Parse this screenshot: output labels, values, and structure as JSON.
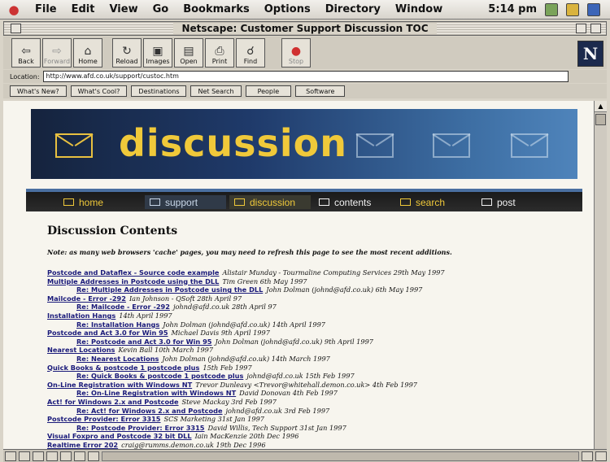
{
  "menubar": {
    "items": [
      "File",
      "Edit",
      "View",
      "Go",
      "Bookmarks",
      "Options",
      "Directory",
      "Window"
    ],
    "clock": "5:14 pm"
  },
  "window": {
    "title": "Netscape: Customer Support Discussion TOC"
  },
  "toolbar": {
    "buttons": [
      {
        "label": "Back",
        "icon": "back-arrow-icon"
      },
      {
        "label": "Forward",
        "icon": "forward-arrow-icon"
      },
      {
        "label": "Home",
        "icon": "home-icon"
      },
      {
        "label": "Reload",
        "icon": "reload-icon"
      },
      {
        "label": "Images",
        "icon": "images-icon"
      },
      {
        "label": "Open",
        "icon": "open-icon"
      },
      {
        "label": "Print",
        "icon": "print-icon"
      },
      {
        "label": "Find",
        "icon": "find-icon"
      },
      {
        "label": "Stop",
        "icon": "stop-icon"
      }
    ],
    "logo": "N"
  },
  "location": {
    "label": "Location:",
    "url": "http://www.afd.co.uk/support/custoc.htm"
  },
  "directory_buttons": [
    "What's New?",
    "What's Cool?",
    "Destinations",
    "Net Search",
    "People",
    "Software"
  ],
  "page": {
    "banner_word": "discussion",
    "nav": [
      "home",
      "support",
      "discussion",
      "contents",
      "search",
      "post"
    ],
    "heading": "Discussion Contents",
    "note": "Note: as many web browsers 'cache' pages, you may need to refresh this page to see the most recent additions.",
    "entries": [
      {
        "link": "Postcode and Dataflex - Source code example",
        "meta": "Alistair Munday - Tourmaline Computing Services 29th May 1997",
        "reply": false
      },
      {
        "link": "Multiple Addresses in Postcode using the DLL",
        "meta": "Tim Green 6th May 1997",
        "reply": false
      },
      {
        "link": "Re: Multiple Addresses in Postcode using the DLL",
        "meta": "John Dolman (johnd@afd.co.uk) 6th May 1997",
        "reply": true
      },
      {
        "link": "Mailcode - Error -292",
        "meta": "Ian Johnson - QSoft 28th April 97",
        "reply": false
      },
      {
        "link": "Re: Mailcode - Error -292",
        "meta": "johnd@afd.co.uk 28th April 97",
        "reply": true
      },
      {
        "link": "Installation Hangs",
        "meta": "14th April 1997",
        "reply": false
      },
      {
        "link": "Re: Installation Hangs",
        "meta": "John Dolman (johnd@afd.co.uk) 14th April 1997",
        "reply": true
      },
      {
        "link": "Postcode and Act 3.0 for Win 95",
        "meta": "Michael Davis 9th April 1997",
        "reply": false
      },
      {
        "link": "Re: Postcode and Act 3.0 for Win 95",
        "meta": "John Dolman (johnd@afd.co.uk) 9th April 1997",
        "reply": true
      },
      {
        "link": "Nearest Locations",
        "meta": "Kevin Ball 10th March 1997",
        "reply": false
      },
      {
        "link": "Re: Nearest Locations",
        "meta": "John Dolman (johnd@afd.co.uk) 14th March 1997",
        "reply": true
      },
      {
        "link": "Quick Books & postcode 1 postcode plus",
        "meta": "15th Feb 1997",
        "reply": false
      },
      {
        "link": "Re: Quick Books & postcode 1 postcode plus",
        "meta": "johnd@afd.co.uk 15th Feb 1997",
        "reply": true
      },
      {
        "link": "On-Line Registration with Windows NT",
        "meta": "Trevor Dunleavy <Trevor@whitehall.demon.co.uk> 4th Feb 1997",
        "reply": false
      },
      {
        "link": "Re: On-Line Registration with Windows NT",
        "meta": "David Donovan 4th Feb 1997",
        "reply": true
      },
      {
        "link": "Act! for Windows 2.x and Postcode",
        "meta": "Steve Mackay 3rd Feb 1997",
        "reply": false
      },
      {
        "link": "Re: Act! for Windows 2.x and Postcode",
        "meta": "johnd@afd.co.uk 3rd Feb 1997",
        "reply": true
      },
      {
        "link": "Postcode Provider: Error 3315",
        "meta": "SCS Marketing 31st Jan 1997",
        "reply": false
      },
      {
        "link": "Re: Postcode Provider: Error 3315",
        "meta": "David Willis, Tech Support 31st Jan 1997",
        "reply": true
      },
      {
        "link": "Visual Foxpro and Postcode 32 bit DLL",
        "meta": "Iain MacKenzie 20th Dec 1996",
        "reply": false
      },
      {
        "link": "Realtime Error 202",
        "meta": "craig@rumms.demon.co.uk 19th Dec 1996",
        "reply": false
      }
    ]
  },
  "colors": {
    "banner_word": "#f0c93a",
    "link": "#1a1a7a",
    "nav_active": "#f0c93a",
    "nav_inactive": "#c8d6e8"
  }
}
